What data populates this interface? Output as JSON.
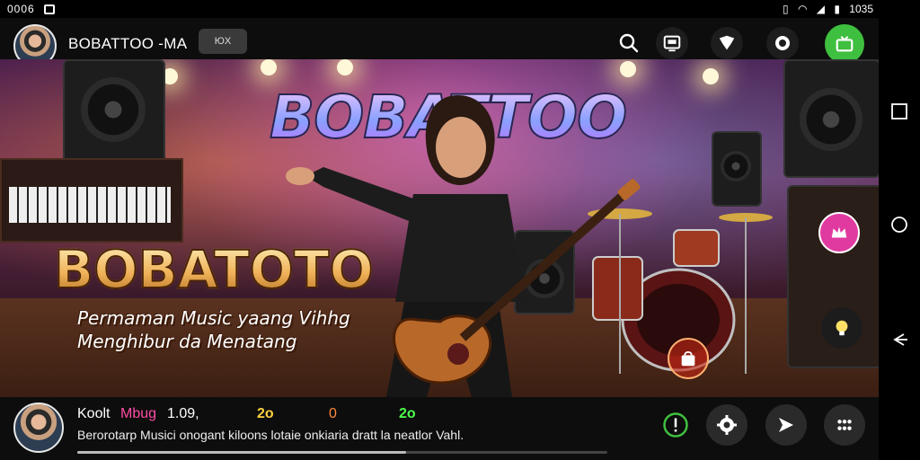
{
  "status_bar": {
    "time": "0006",
    "right_text": "1035"
  },
  "header": {
    "title": "BOBATTOO -MA",
    "chip_label": "ЮX"
  },
  "hero": {
    "logo_top": "BOBATTOO",
    "logo_main": "BOBATOTO",
    "tagline_line1": "Permaman Music yaang Vihhg",
    "tagline_line2": "Menghibur da Menatang"
  },
  "info_bar": {
    "stat_koolt": "Koolt",
    "stat_mbug": "Mbug",
    "stat_value": "1.09,",
    "stat_2o_a": "2o",
    "stat_zero": "0",
    "stat_2o_b": "2o",
    "description": "Berorotarp Musici onogant kiloons lotaie onkiaria dratt la neatlor Vahl.",
    "progress": 0.62
  },
  "colors": {
    "accent_green": "#3fbf3f",
    "accent_pink": "#e03aa0",
    "stat_pink": "#ff4da6",
    "stat_yellow": "#ffd23f",
    "stat_orange": "#ff8a3d",
    "stat_green": "#4cff4c"
  }
}
